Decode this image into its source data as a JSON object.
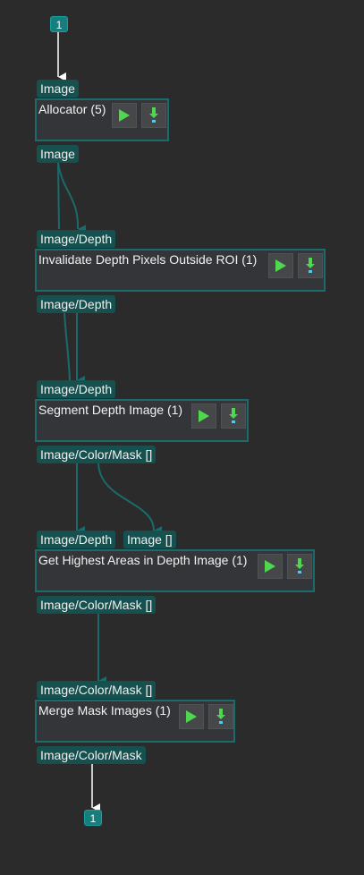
{
  "entry_terminal": "1",
  "exit_terminal": "1",
  "colors": {
    "background": "#2b2b2b",
    "accent": "#177e7e",
    "port": "#16504f",
    "node": "#333538",
    "play": "#4fd84f",
    "download": "#58c8e8"
  },
  "nodes": [
    {
      "title": "Allocator (5)",
      "inputs": [
        "Image"
      ],
      "outputs": [
        "Image"
      ]
    },
    {
      "title": "Invalidate Depth Pixels Outside ROI (1)",
      "inputs": [
        "Image/Depth"
      ],
      "outputs": [
        "Image/Depth"
      ]
    },
    {
      "title": "Segment Depth Image (1)",
      "inputs": [
        "Image/Depth"
      ],
      "outputs": [
        "Image/Color/Mask []"
      ]
    },
    {
      "title": "Get Highest Areas in Depth Image (1)",
      "inputs": [
        "Image/Depth",
        "Image []"
      ],
      "outputs": [
        "Image/Color/Mask []"
      ]
    },
    {
      "title": "Merge Mask Images (1)",
      "inputs": [
        "Image/Color/Mask []"
      ],
      "outputs": [
        "Image/Color/Mask"
      ]
    }
  ],
  "buttons": {
    "run_icon": "play-icon",
    "step_icon": "download-arrow-icon"
  }
}
